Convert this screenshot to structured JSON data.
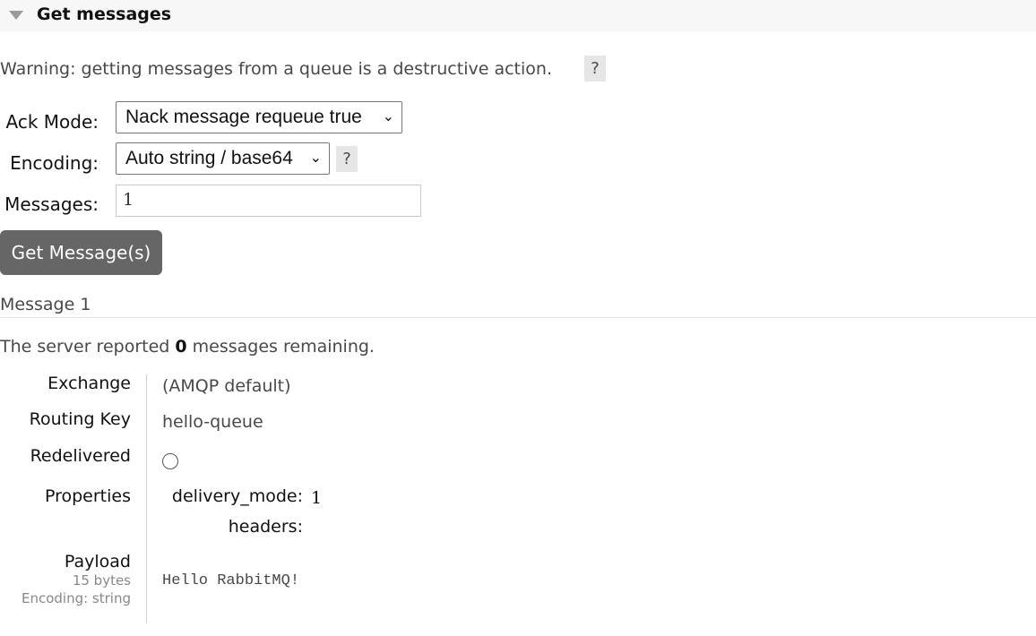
{
  "section": {
    "title": "Get messages"
  },
  "warning": {
    "text": "Warning: getting messages from a queue is a destructive action.",
    "help": "?"
  },
  "form": {
    "ack_mode": {
      "label": "Ack Mode:",
      "selected": "Nack message requeue true"
    },
    "encoding": {
      "label": "Encoding:",
      "selected": "Auto string / base64",
      "help": "?"
    },
    "messages": {
      "label": "Messages:",
      "value": "1"
    },
    "submit_label": "Get Message(s)"
  },
  "result": {
    "message_title": "Message 1",
    "remaining_prefix": "The server reported ",
    "remaining_count": "0",
    "remaining_suffix": " messages remaining.",
    "exchange": {
      "label": "Exchange",
      "value": "(AMQP default)"
    },
    "routing_key": {
      "label": "Routing Key",
      "value": "hello-queue"
    },
    "redelivered": {
      "label": "Redelivered",
      "checked": false
    },
    "properties": {
      "label": "Properties",
      "delivery_mode_key": "delivery_mode:",
      "delivery_mode_value": "1",
      "headers_key": "headers:"
    },
    "payload": {
      "label": "Payload",
      "size": "15 bytes",
      "encoding": "Encoding: string",
      "value": "Hello RabbitMQ!"
    }
  },
  "colors": {
    "button_bg": "#666666",
    "header_bg": "#f7f7f7",
    "help_bg": "#e6e6e6"
  }
}
